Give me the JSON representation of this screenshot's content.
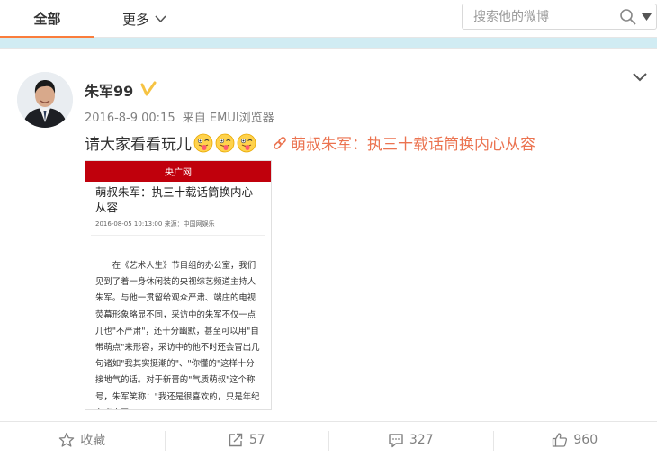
{
  "nav": {
    "tab_all": "全部",
    "tab_more": "更多",
    "search_placeholder": "搜索他的微博"
  },
  "post": {
    "username": "朱军99",
    "date": "2016-8-9 00:15",
    "source": "来自 EMUI浏览器",
    "text": "请大家看看玩儿",
    "emoji": [
      "tongue-wink-emoji",
      "tongue-wink-emoji",
      "tongue-wink-emoji"
    ],
    "link_text": "萌叔朱军：执三十载话筒换内心从容",
    "preview": {
      "site": "央广网",
      "title": "萌叔朱军：执三十载话筒换内心从容",
      "meta": "2016-08-05 10:13:00 来源：中国网娱乐",
      "body": "在《艺术人生》节目组的办公室，我们见到了着一身休闲装的央视综艺频道主持人朱军。与他一贯留给观众严肃、端庄的电视荧幕形象略显不同，采访中的朱军不仅一点儿也\"不严肃\"，还十分幽默，甚至可以用\"自带萌点\"来形容，采访中的他不时还会冒出几句诸如\"我其实挺潮的\"、\"你懂的\"这样十分接地气的话。对于新晋的\"气质萌叔\"这个称号，朱军笑称：\"我还是很喜欢的，只是年纪有点大了。\""
    }
  },
  "actions": {
    "favorite": "收藏",
    "repost": "57",
    "comment": "327",
    "like": "960"
  },
  "colors": {
    "accent": "#fa7d3c",
    "link": "#eb7350",
    "verified": "#f6c343",
    "stripe": "#d1ecf3",
    "preview_header": "#c0000c"
  }
}
